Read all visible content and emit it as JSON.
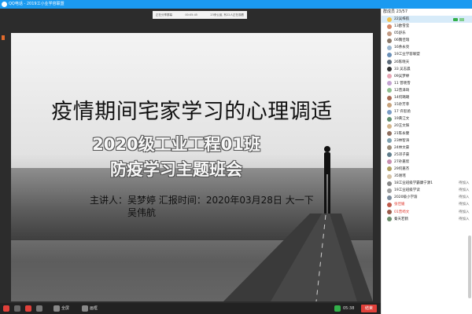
{
  "window": {
    "title": "QQ电话 - 2019工小业学容联盟"
  },
  "notice": {
    "left": "正在分享屏幕",
    "mid": "00:05:45",
    "right": "23来公宣, 有22人正在观看"
  },
  "slide": {
    "title": "疫情期间宅家学习的心理调适",
    "subtitle1": "2020级工业工程01班",
    "subtitle2": "防疫学习主题班会",
    "speaker_line1": "主讲人：吴梦婷  汇报时间：2020年03月28日 大一下",
    "speaker_line2": "吴伟航"
  },
  "bottombar": {
    "fullscreen_label": "全屏",
    "minimize_label": "画框",
    "time": "05:38",
    "end_label": "结束"
  },
  "panel": {
    "header": "群成员 23/57",
    "members": [
      {
        "name": "22吴梓航",
        "tag": "",
        "color": "#f0c14b",
        "active": true,
        "speaking": true
      },
      {
        "name": "13欧雪莹",
        "tag": "",
        "color": "#d68a6a"
      },
      {
        "name": "05舒乐",
        "tag": "",
        "color": "#c39c85"
      },
      {
        "name": "06魏佳瑞",
        "tag": "",
        "color": "#8c7a6b"
      },
      {
        "name": "16余永亮",
        "tag": "",
        "color": "#9bb6cf"
      },
      {
        "name": "19工业学容联盟",
        "tag": "",
        "color": "#6a8fb7"
      },
      {
        "name": "26陈晓天",
        "tag": "",
        "color": "#5d6b7a"
      },
      {
        "name": "33 吴志晨",
        "tag": "",
        "color": "#333"
      },
      {
        "name": "09吴梦婷",
        "tag": "",
        "color": "#e6a5b4"
      },
      {
        "name": "11 曾晓雪",
        "tag": "",
        "color": "#c4a4d2"
      },
      {
        "name": "12曾泽琦",
        "tag": "",
        "color": "#8fbf8f"
      },
      {
        "name": "14何璐璐",
        "tag": "",
        "color": "#a86c55"
      },
      {
        "name": "15孙芳菲",
        "tag": "",
        "color": "#c7a37d"
      },
      {
        "name": "17 许思涵",
        "tag": "",
        "color": "#7a9cc6"
      },
      {
        "name": "19黄江文",
        "tag": "",
        "color": "#5f8f6f"
      },
      {
        "name": "20王文辉",
        "tag": "",
        "color": "#d2b48c"
      },
      {
        "name": "21陈永健",
        "tag": "",
        "color": "#8f6f5f"
      },
      {
        "name": "23林智涛",
        "tag": "",
        "color": "#7ea1b0"
      },
      {
        "name": "24林文豪",
        "tag": "",
        "color": "#9a8c7a"
      },
      {
        "name": "25邓子豪",
        "tag": "",
        "color": "#607d8b"
      },
      {
        "name": "27孙嘉欣",
        "tag": "",
        "color": "#c98fb0"
      },
      {
        "name": "29何嘉杰",
        "tag": "",
        "color": "#b0a060"
      },
      {
        "name": "35谢瑶",
        "tag": "",
        "color": "#d4c1a5"
      },
      {
        "name": "18工业班级学霸康宁源1",
        "tag": "待加入",
        "color": "#888"
      },
      {
        "name": "19工业班级学读",
        "tag": "待加入",
        "color": "#a0a0a0"
      },
      {
        "name": "2020级小学渝",
        "tag": "待加入",
        "color": "#7c8c9c"
      },
      {
        "name": "张佳媛",
        "tag": "待加入",
        "color": "#c05a4a",
        "red": true
      },
      {
        "name": "01曾崎文",
        "tag": "待加入",
        "color": "#9a5a4a",
        "red": true
      },
      {
        "name": "秦天若鹤",
        "tag": "待加入",
        "color": "#6b8e6b"
      }
    ]
  },
  "colors": {
    "titlebar": "#1b9af0",
    "end_button": "#e0403a",
    "active_row": "#d7ebf9"
  }
}
